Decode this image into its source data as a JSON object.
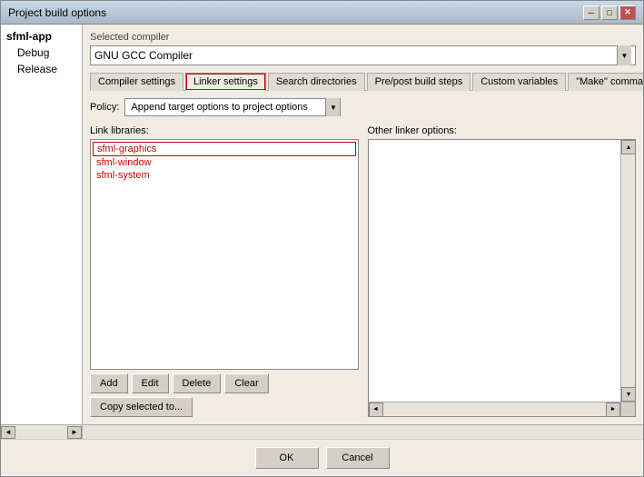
{
  "window": {
    "title": "Project build options",
    "title_btn_min": "─",
    "title_btn_max": "□",
    "title_btn_close": "✕"
  },
  "sidebar": {
    "items": [
      {
        "label": "sfml-app",
        "type": "root"
      },
      {
        "label": "Debug",
        "type": "child"
      },
      {
        "label": "Release",
        "type": "child"
      }
    ],
    "nav_left": "◄",
    "nav_right": "►"
  },
  "compiler": {
    "label": "Selected compiler",
    "value": "GNU GCC Compiler",
    "dropdown_arrow": "▼"
  },
  "tabs": [
    {
      "label": "Compiler settings",
      "active": false
    },
    {
      "label": "Linker settings",
      "active": true
    },
    {
      "label": "Search directories",
      "active": false
    },
    {
      "label": "Pre/post build steps",
      "active": false
    },
    {
      "label": "Custom variables",
      "active": false
    },
    {
      "label": "\"Make\" commands",
      "active": false
    }
  ],
  "policy": {
    "label": "Policy:",
    "value": "Append target options to project options",
    "dropdown_arrow": "▼"
  },
  "link_libraries": {
    "label": "Link libraries:",
    "items": [
      {
        "text": "sfml-graphics"
      },
      {
        "text": "sfml-window"
      },
      {
        "text": "sfml-system"
      }
    ]
  },
  "other_linker": {
    "label": "Other linker options:"
  },
  "buttons": {
    "add": "Add",
    "edit": "Edit",
    "delete": "Delete",
    "clear": "Clear",
    "copy_selected": "Copy selected to..."
  },
  "footer": {
    "ok": "OK",
    "cancel": "Cancel"
  },
  "scroll": {
    "up": "▲",
    "down": "▼",
    "left": "◄",
    "right": "►"
  }
}
